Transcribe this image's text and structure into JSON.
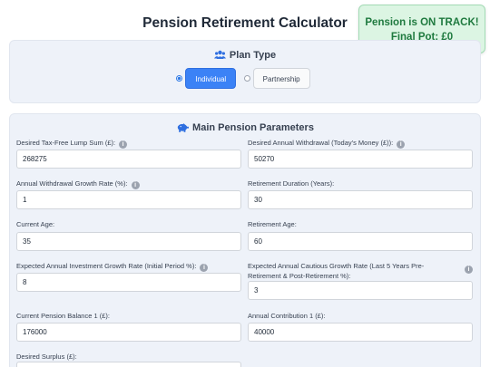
{
  "header": {
    "title": "Pension Retirement Calculator"
  },
  "status": {
    "line1": "Pension is ON TRACK!",
    "line2": "Final Pot: £0",
    "color": "#1f7a3f",
    "background": "#dcf5e3"
  },
  "plan_type": {
    "heading": "Plan Type",
    "icon": "users-icon",
    "options": [
      {
        "label": "Individual",
        "selected": true
      },
      {
        "label": "Partnership",
        "selected": false
      }
    ]
  },
  "main_params": {
    "heading": "Main Pension Parameters",
    "icon": "piggy-bank-icon",
    "fields": {
      "lump_sum": {
        "label": "Desired Tax-Free Lump Sum (£):",
        "value": "268275",
        "has_info": true
      },
      "annual_withdrawal": {
        "label": "Desired Annual Withdrawal (Today's Money (£)):",
        "value": "50270",
        "has_info": true
      },
      "withdrawal_growth": {
        "label": "Annual Withdrawal Growth Rate (%):",
        "value": "1",
        "has_info": true
      },
      "retirement_duration": {
        "label": "Retirement Duration (Years):",
        "value": "30",
        "has_info": false
      },
      "current_age": {
        "label": "Current Age:",
        "value": "35",
        "has_info": false
      },
      "retirement_age": {
        "label": "Retirement Age:",
        "value": "60",
        "has_info": false
      },
      "investment_growth": {
        "label": "Expected Annual Investment Growth Rate (Initial Period %):",
        "value": "8",
        "has_info": true
      },
      "cautious_growth": {
        "label": "Expected Annual Cautious Growth Rate (Last 5 Years Pre-Retirement & Post-Retirement %):",
        "value": "3",
        "has_info": true
      },
      "pension_balance": {
        "label": "Current Pension Balance 1 (£):",
        "value": "176000",
        "has_info": false
      },
      "annual_contribution": {
        "label": "Annual Contribution 1 (£):",
        "value": "40000",
        "has_info": false
      },
      "desired_surplus": {
        "label": "Desired Surplus (£):",
        "value": "",
        "has_info": false
      }
    }
  },
  "info_icon_glyph": "i"
}
